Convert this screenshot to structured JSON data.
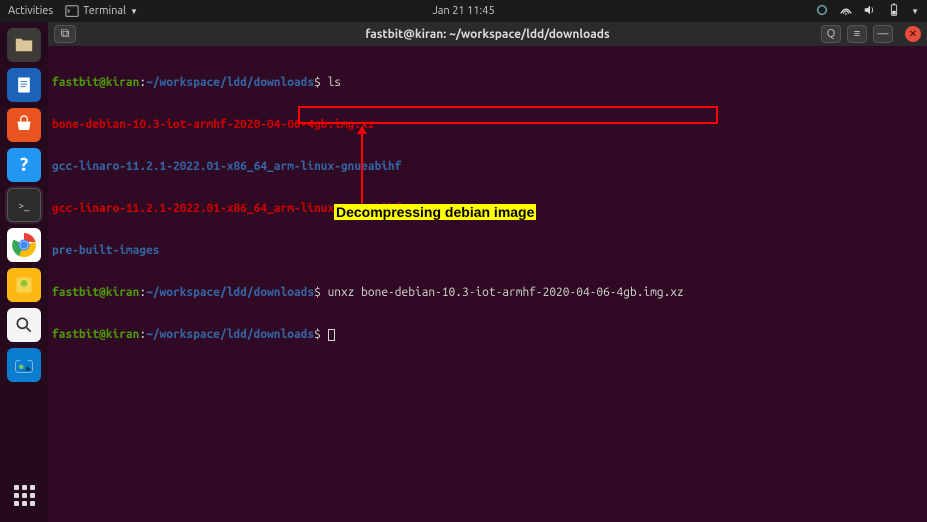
{
  "top_panel": {
    "activities": "Activities",
    "app_name": "Terminal",
    "datetime": "Jan 21  11:45"
  },
  "launcher": {
    "items": [
      {
        "name": "files-icon",
        "glyph": "📁"
      },
      {
        "name": "documents-icon",
        "glyph": "📄"
      },
      {
        "name": "software-icon",
        "glyph": "A"
      },
      {
        "name": "help-icon",
        "glyph": "?"
      },
      {
        "name": "terminal-icon",
        "glyph": ">_"
      },
      {
        "name": "chrome-icon",
        "glyph": ""
      },
      {
        "name": "notes-icon",
        "glyph": "💡"
      },
      {
        "name": "search-icon",
        "glyph": "🔍"
      },
      {
        "name": "screenshot-icon",
        "glyph": "📷"
      }
    ]
  },
  "window": {
    "title": "fastbit@kiran: ~/workspace/ldd/downloads",
    "new_tab_glyph": "⧉",
    "search_glyph": "Q",
    "menu_glyph": "≡",
    "minimize_glyph": "—",
    "close_glyph": "✕"
  },
  "terminal": {
    "prompt_user": "fastbit@kiran",
    "prompt_colon": ":",
    "prompt_path": "~/workspace/ldd/downloads",
    "prompt_dollar": "$",
    "lines": {
      "cmd_ls": " ls",
      "out1": "bone-debian-10.3-iot-armhf-2020-04-06-4gb.img.xz",
      "out2": "gcc-linaro-11.2.1-2022.01-x86_64_arm-linux-gnueabihf",
      "out3": "gcc-linaro-11.2.1-2022.01-x86_64_arm-linux-gnueabihf.tar.xz",
      "out4": "pre-built-images",
      "cmd_unxz": " unxz bone-debian-10.3-iot-armhf-2020-04-06-4gb.img.xz"
    }
  },
  "annotation": {
    "text": "Decompressing debian image"
  }
}
